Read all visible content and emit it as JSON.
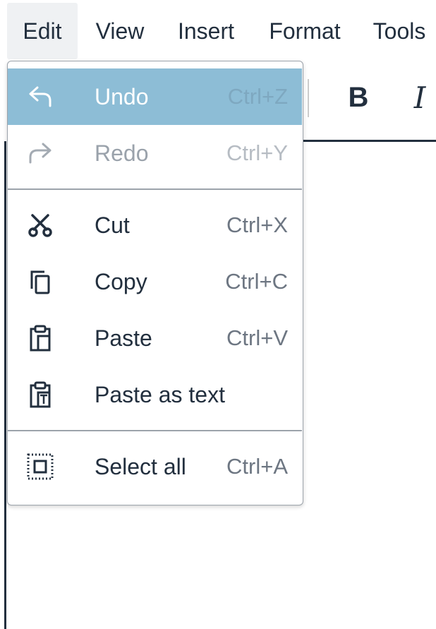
{
  "menubar": {
    "items": [
      {
        "label": "Edit",
        "active": true
      },
      {
        "label": "View"
      },
      {
        "label": "Insert"
      },
      {
        "label": "Format"
      },
      {
        "label": "Tools"
      }
    ]
  },
  "toolbar": {
    "bold_label": "B",
    "italic_label": "I"
  },
  "edit_menu": {
    "items": [
      {
        "label": "Undo",
        "shortcut": "Ctrl+Z",
        "icon": "undo-icon",
        "state": "highlighted"
      },
      {
        "label": "Redo",
        "shortcut": "Ctrl+Y",
        "icon": "redo-icon",
        "state": "disabled"
      },
      {
        "label": "Cut",
        "shortcut": "Ctrl+X",
        "icon": "scissors-icon"
      },
      {
        "label": "Copy",
        "shortcut": "Ctrl+C",
        "icon": "copy-icon"
      },
      {
        "label": "Paste",
        "shortcut": "Ctrl+V",
        "icon": "paste-icon"
      },
      {
        "label": "Paste as text",
        "shortcut": "",
        "icon": "paste-text-icon"
      },
      {
        "label": "Select all",
        "shortcut": "Ctrl+A",
        "icon": "select-all-icon"
      }
    ]
  },
  "colors": {
    "highlight": "#8dbdd6",
    "text": "#222f3e",
    "disabled_text": "#9aa2ab"
  }
}
